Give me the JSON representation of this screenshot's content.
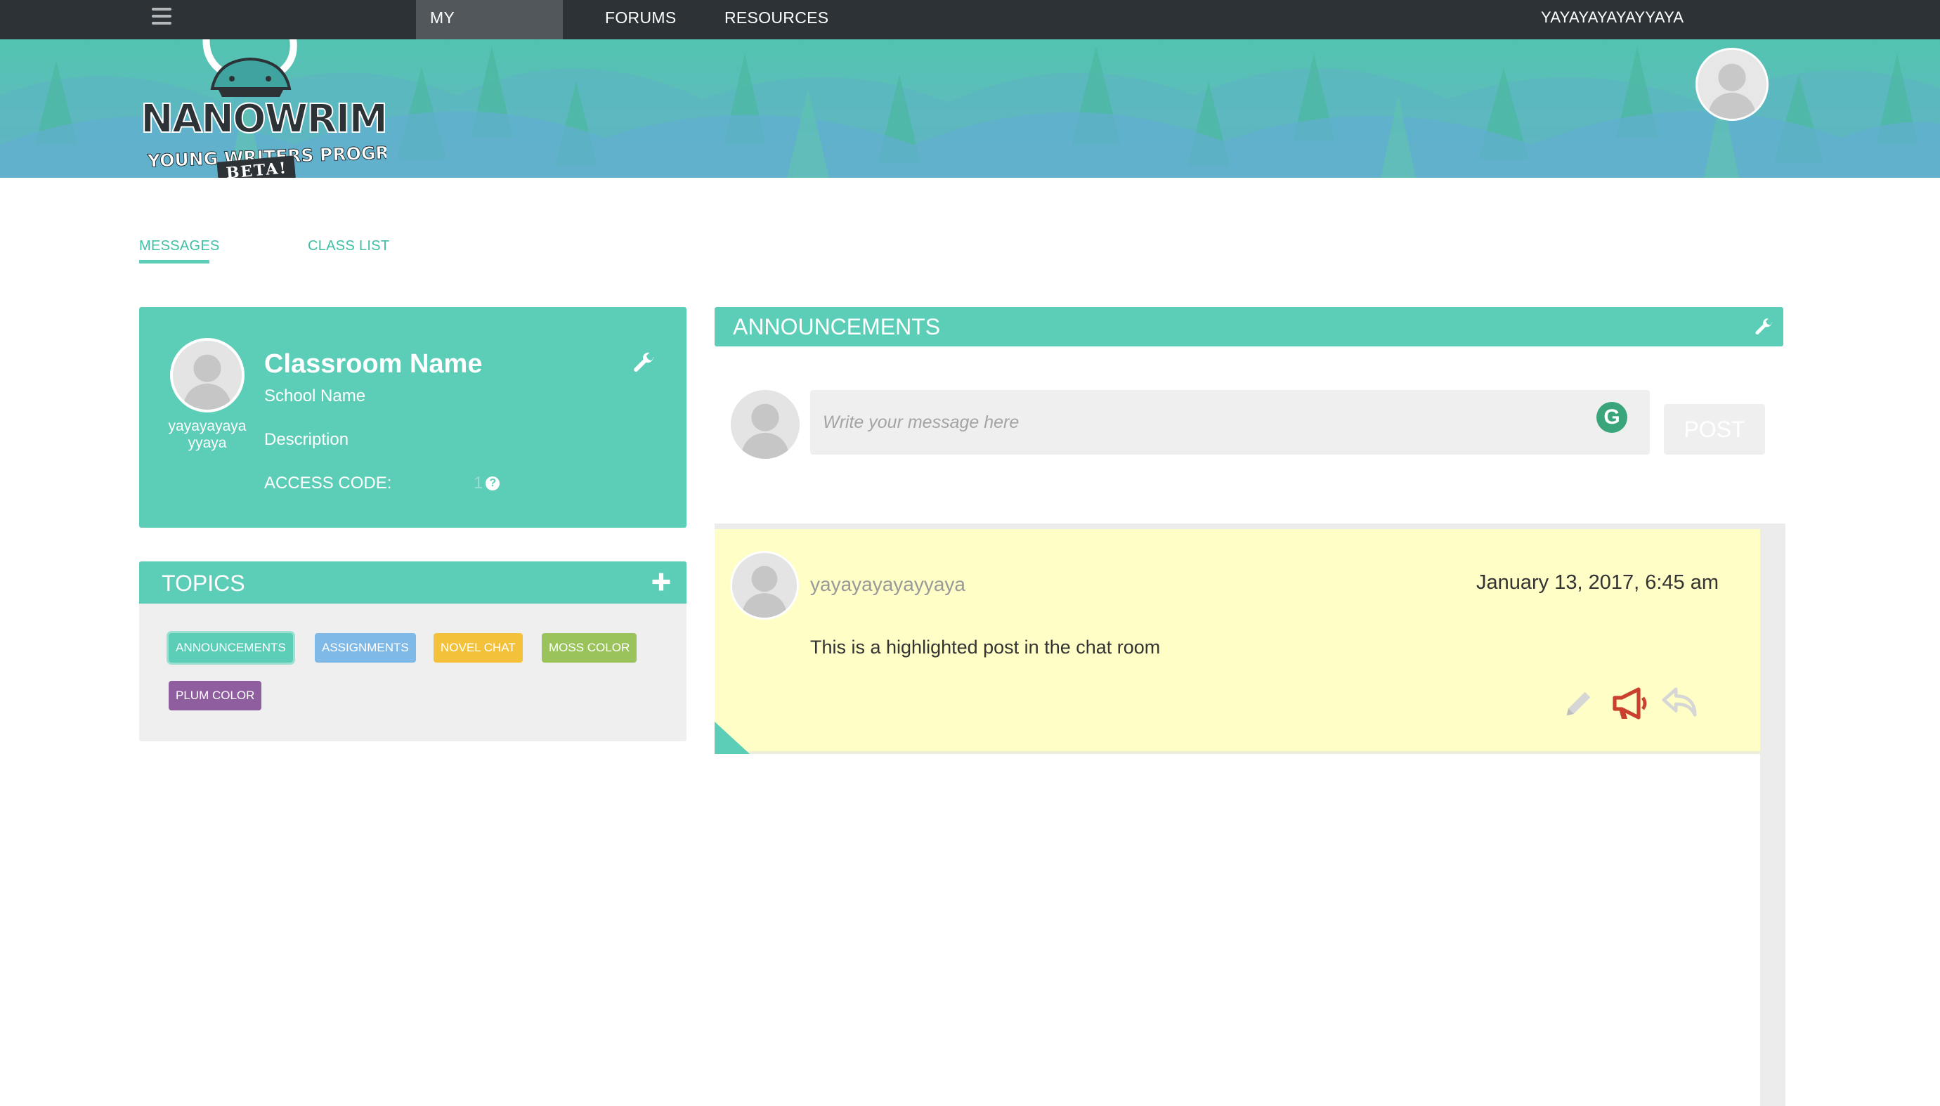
{
  "topbar": {
    "menu_icon": "hamburger-menu-icon",
    "nav": [
      {
        "label": "MY CLASSROOM",
        "active": true
      },
      {
        "label": "FORUMS",
        "active": false
      },
      {
        "label": "RESOURCES",
        "active": false
      }
    ],
    "username": "YAYAYAYAYAYYAYA"
  },
  "banner": {
    "logo": {
      "title": "NANOWRIMO",
      "subtitle": "YOUNG WRITERS PROGRAM",
      "badge": "BETA!"
    }
  },
  "tabs": [
    {
      "label": "MESSAGES",
      "active": true
    },
    {
      "label": "CLASS LIST",
      "active": false
    }
  ],
  "classroom": {
    "owner": "yayayayayayyaya",
    "name": "Classroom Name",
    "school": "School Name",
    "description": "Description",
    "access_code_label": "ACCESS CODE:",
    "access_code_value": "1",
    "help_icon": "question-circle-icon",
    "settings_icon": "wrench-icon"
  },
  "topics": {
    "title": "TOPICS",
    "add_icon": "plus-icon",
    "items": [
      {
        "label": "ANNOUNCEMENTS",
        "color": "#5ccdb7",
        "selected": true
      },
      {
        "label": "ASSIGNMENTS",
        "color": "#7fb9e8"
      },
      {
        "label": "NOVEL CHAT",
        "color": "#f4c23a"
      },
      {
        "label": "MOSS COLOR",
        "color": "#9ac45b"
      },
      {
        "label": "PLUM COLOR",
        "color": "#8f5e9e"
      }
    ]
  },
  "announcements": {
    "title": "ANNOUNCEMENTS",
    "settings_icon": "wrench-icon",
    "compose": {
      "placeholder": "Write your message here",
      "value": "",
      "grammarly_icon": "G",
      "post_label": "POST"
    },
    "posts": [
      {
        "author": "yayayayayayyaya",
        "date": "January 13, 2017, 6:45 am",
        "body": "This is a highlighted post in the chat room",
        "highlighted": true,
        "actions": [
          "pencil-icon",
          "megaphone-icon",
          "reply-icon"
        ]
      }
    ]
  },
  "colors": {
    "teal": "#5ccdb7",
    "topbar": "#2c3236",
    "highlight_bg": "#fefec6",
    "megaphone": "#c9412e"
  }
}
